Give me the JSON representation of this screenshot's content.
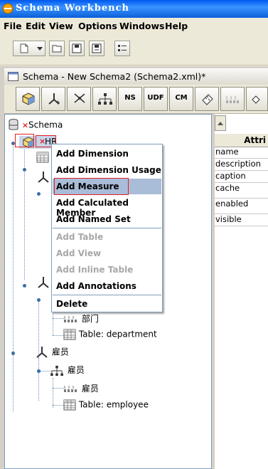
{
  "window": {
    "title": "Schema Workbench"
  },
  "menubar": [
    "File",
    "Edit",
    "View",
    "Options",
    "Windows",
    "Help"
  ],
  "document": {
    "title": "Schema - New Schema2 (Schema2.xml)*"
  },
  "schema_toolbar": [
    {
      "name": "add-cube",
      "label": ""
    },
    {
      "name": "add-dimension",
      "label": ""
    },
    {
      "name": "add-dimension-usage",
      "label": ""
    },
    {
      "name": "add-hierarchy",
      "label": ""
    },
    {
      "name": "add-named-set",
      "label": "NS"
    },
    {
      "name": "add-udf",
      "label": "UDF"
    },
    {
      "name": "add-calculated-member",
      "label": "CM"
    },
    {
      "name": "add-measure",
      "label": ""
    },
    {
      "name": "add-level",
      "label": ""
    },
    {
      "name": "add-property",
      "label": ""
    }
  ],
  "tree": {
    "root": "Schema",
    "cube": "HR",
    "dept_level": "部门",
    "dept_table": "Table: department",
    "emp_dimension": "雇员",
    "emp_hierarchy": "雇员",
    "emp_level": "雇员",
    "emp_table": "Table: employee"
  },
  "properties": {
    "header": "Attri",
    "rows": [
      "name",
      "description",
      "caption",
      "cache",
      "enabled",
      "visible"
    ]
  },
  "context_menu": {
    "items": [
      {
        "label": "Add Dimension",
        "enabled": true
      },
      {
        "label": "Add Dimension Usage",
        "enabled": true
      },
      {
        "label": "Add Measure",
        "enabled": true,
        "highlighted": true
      },
      {
        "label": "Add Calculated Member",
        "enabled": true
      },
      {
        "label": "Add Named Set",
        "enabled": true
      },
      {
        "label": "Add Table",
        "enabled": false
      },
      {
        "label": "Add View",
        "enabled": false
      },
      {
        "label": "Add Inline Table",
        "enabled": false
      },
      {
        "label": "Add Annotations",
        "enabled": true
      },
      {
        "label": "Delete",
        "enabled": true
      }
    ]
  },
  "colors": {
    "error_mark": "#e02020",
    "highlight": "#a9bcd8",
    "title_bar": "#0a5fd8"
  }
}
